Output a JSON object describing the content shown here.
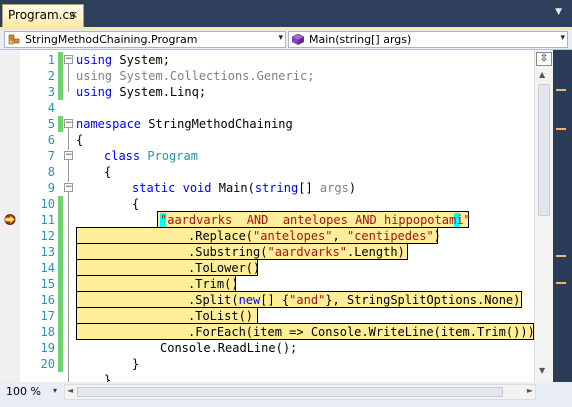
{
  "tab": {
    "label": "Program.cs",
    "close": "×",
    "dropdown": "▼"
  },
  "nav": {
    "class_combo": "StringMethodChaining.Program",
    "member_combo": "Main(string[] args)",
    "arrow": "▾"
  },
  "lines": [
    {
      "n": "1"
    },
    {
      "n": "2"
    },
    {
      "n": "3"
    },
    {
      "n": "4"
    },
    {
      "n": "5"
    },
    {
      "n": "6"
    },
    {
      "n": "7"
    },
    {
      "n": "8"
    },
    {
      "n": "9"
    },
    {
      "n": "10"
    },
    {
      "n": "11"
    },
    {
      "n": "12"
    },
    {
      "n": "13"
    },
    {
      "n": "14"
    },
    {
      "n": "15"
    },
    {
      "n": "16"
    },
    {
      "n": "17"
    },
    {
      "n": "18"
    },
    {
      "n": "19"
    },
    {
      "n": "20"
    }
  ],
  "code": {
    "l1_kw": "using",
    "l1_rest": " System;",
    "l2": "using System.Collections.Generic;",
    "l3_kw": "using",
    "l3_rest": " System.Linq;",
    "l5_kw": "namespace",
    "l5_rest": " StringMethodChaining",
    "l6": "{",
    "l7_kw": "class",
    "l7_type": "Program",
    "l8": "{",
    "l9_kw1": "static",
    "l9_kw2": "void",
    "l9_main": " Main(",
    "l9_kw3": "string",
    "l9_br": "[] ",
    "l9_args": "args",
    "l9_end": ")",
    "l10": "{",
    "l11_str": "\"aardvarks  AND  antelopes AND hippopotami\"",
    "l12_a": ".Replace(",
    "l12_s1": "\"antelopes\"",
    "l12_b": ", ",
    "l12_s2": "\"centipedes\"",
    "l12_c": ")",
    "l13_a": ".Substring(",
    "l13_s": "\"aardvarks\"",
    "l13_b": ".Length)",
    "l14": ".ToLower()",
    "l15": ".Trim()",
    "l16_a": ".Split(",
    "l16_kw": "new",
    "l16_b": "[] {",
    "l16_s": "\"and\"",
    "l16_c": "}, StringSplitOptions.None)",
    "l17": ".ToList()",
    "l18": ".ForEach(item => Console.WriteLine(item.Trim()));",
    "l19": "Console.ReadLine();",
    "l20": "}",
    "l21": "}"
  },
  "fold_minus": "−",
  "scroll": {
    "up": "▲",
    "down": "▼",
    "left": "◄",
    "right": "►",
    "split": "⇳"
  },
  "zoom": {
    "value": "100 %",
    "arrow": "▾"
  },
  "colors": {
    "highlight": "#ffee99",
    "keyword": "#0000ff",
    "type": "#2b91af",
    "string": "#a31515",
    "change_bar": "#6fd16f"
  }
}
